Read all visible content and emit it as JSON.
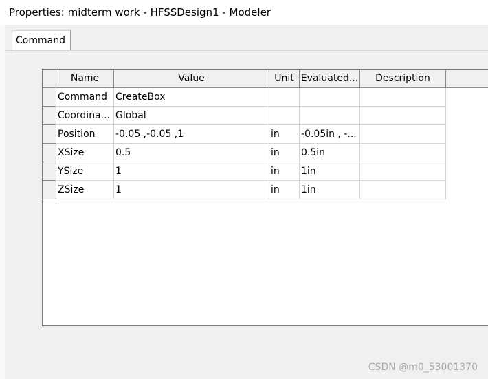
{
  "window": {
    "title": "Properties: midterm work - HFSSDesign1 - Modeler"
  },
  "tabs": [
    {
      "label": "Command"
    }
  ],
  "table": {
    "headers": [
      "Name",
      "Value",
      "Unit",
      "Evaluated...",
      "Description"
    ],
    "rows": [
      {
        "name": "Command",
        "value": "CreateBox",
        "unit": "",
        "evaluated": "",
        "description": ""
      },
      {
        "name": "Coordina...",
        "value": "Global",
        "unit": "",
        "evaluated": "",
        "description": ""
      },
      {
        "name": "Position",
        "value": "-0.05 ,-0.05 ,1",
        "unit": "in",
        "evaluated": "-0.05in , -...",
        "description": ""
      },
      {
        "name": "XSize",
        "value": "0.5",
        "unit": "in",
        "evaluated": "0.5in",
        "description": ""
      },
      {
        "name": "YSize",
        "value": "1",
        "unit": "in",
        "evaluated": "1in",
        "description": ""
      },
      {
        "name": "ZSize",
        "value": "1",
        "unit": "in",
        "evaluated": "1in",
        "description": ""
      }
    ]
  },
  "watermark": "CSDN @m0_53001370"
}
